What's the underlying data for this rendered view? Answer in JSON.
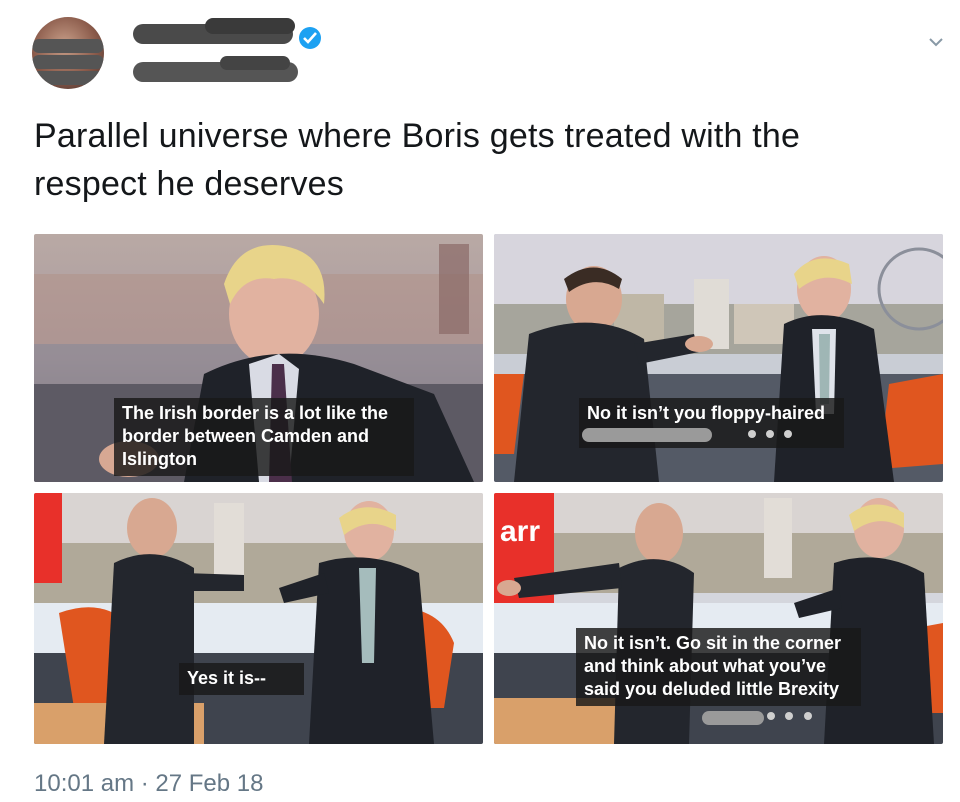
{
  "tweet": {
    "text": "Parallel universe where Boris gets treated with the respect he deserves",
    "timestamp": "10:01 am · 27 Feb 18",
    "verified": true
  },
  "media": {
    "captions": {
      "panel1": "The Irish border is a lot like the border between Camden and Islington",
      "panel2": "No it isn’t you floppy-haired",
      "panel3": "Yes it is--",
      "panel4": "No it isn’t. Go sit in the corner and think about what you’ve said you deluded little Brexity"
    },
    "logo_text": "arr"
  },
  "colors": {
    "verified": "#1da1f2",
    "timestamp": "#657786",
    "caption_bg": "#191919",
    "chair_orange": "#e0561f",
    "studio_red": "#e8302a"
  }
}
